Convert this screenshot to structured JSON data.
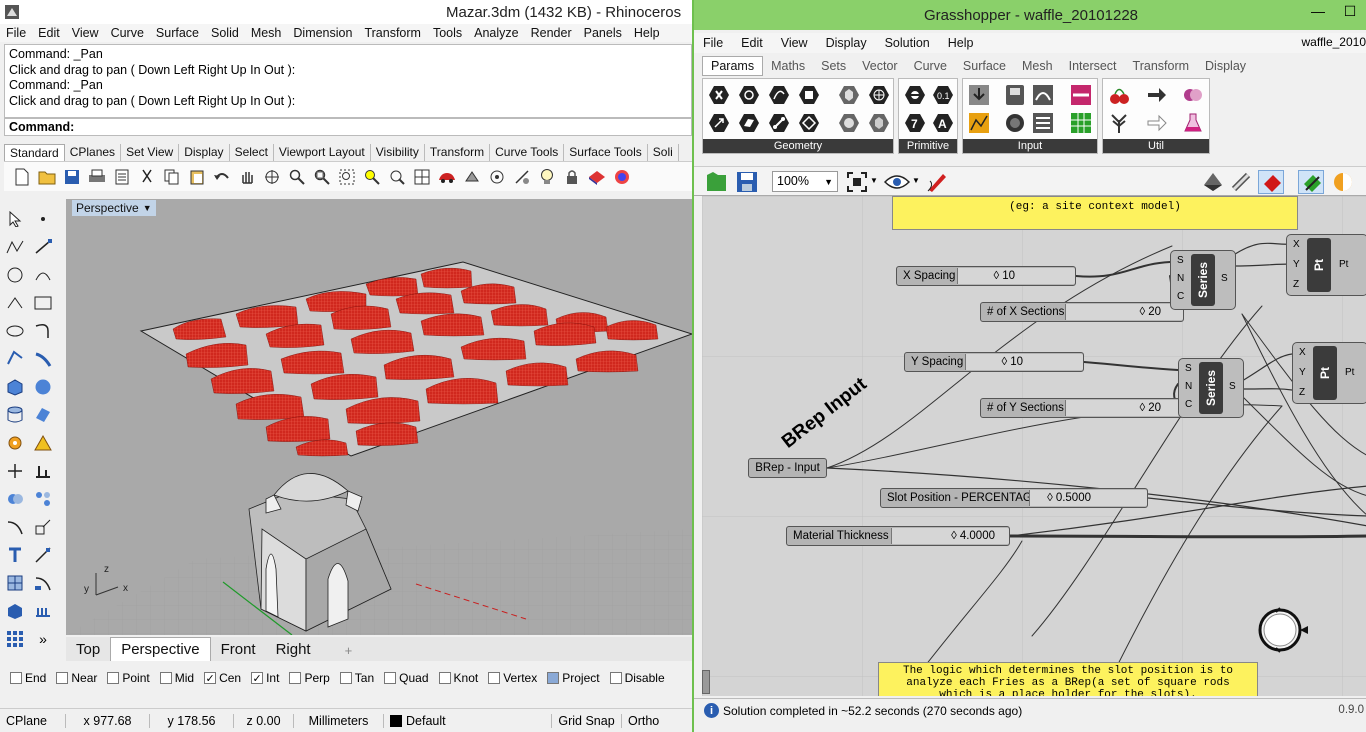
{
  "rhino": {
    "title": "Mazar.3dm (1432 KB) - Rhinoceros",
    "menu": [
      "File",
      "Edit",
      "View",
      "Curve",
      "Surface",
      "Solid",
      "Mesh",
      "Dimension",
      "Transform",
      "Tools",
      "Analyze",
      "Render",
      "Panels",
      "Help"
    ],
    "command_history": [
      "Command: _Pan",
      "Click and drag to pan ( Down  Left  Right  Up  In  Out ):",
      "Command: _Pan",
      "Click and drag to pan ( Down  Left  Right  Up  In  Out ):"
    ],
    "command_prompt": "Command:",
    "toolbar_tabs": [
      "Standard",
      "CPlanes",
      "Set View",
      "Display",
      "Select",
      "Viewport Layout",
      "Visibility",
      "Transform",
      "Curve Tools",
      "Surface Tools",
      "Soli"
    ],
    "viewport_label": "Perspective",
    "viewport_tabs": [
      "Top",
      "Perspective",
      "Front",
      "Right",
      "+"
    ],
    "active_viewport_tab": "Perspective",
    "axis_labels": {
      "x": "x",
      "y": "y",
      "z": "z"
    },
    "osnaps": [
      {
        "label": "End",
        "checked": false
      },
      {
        "label": "Near",
        "checked": false
      },
      {
        "label": "Point",
        "checked": false
      },
      {
        "label": "Mid",
        "checked": false
      },
      {
        "label": "Cen",
        "checked": true
      },
      {
        "label": "Int",
        "checked": true
      },
      {
        "label": "Perp",
        "checked": false
      },
      {
        "label": "Tan",
        "checked": false
      },
      {
        "label": "Quad",
        "checked": false
      },
      {
        "label": "Knot",
        "checked": false
      },
      {
        "label": "Vertex",
        "checked": false
      },
      {
        "label": "Project",
        "checked": true
      },
      {
        "label": "Disable",
        "checked": false
      }
    ],
    "status": {
      "cplane": "CPlane",
      "x": "x 977.68",
      "y": "y 178.56",
      "z": "z 0.00",
      "units": "Millimeters",
      "layer": "Default",
      "grid_snap": "Grid Snap",
      "ortho": "Ortho"
    }
  },
  "grasshopper": {
    "title": "Grasshopper - waffle_20101228",
    "doc_name": "waffle_2010",
    "menu": [
      "File",
      "Edit",
      "View",
      "Display",
      "Solution",
      "Help"
    ],
    "tabs": [
      "Params",
      "Maths",
      "Sets",
      "Vector",
      "Curve",
      "Surface",
      "Mesh",
      "Intersect",
      "Transform",
      "Display"
    ],
    "active_tab": "Params",
    "ribbon_groups": [
      "Geometry",
      "Primitive",
      "Input",
      "Util"
    ],
    "zoom": "100%",
    "note_top": "(eg: a site context model)",
    "group_label": "BRep Input",
    "sliders": [
      {
        "name": "X Spacing",
        "value": "10"
      },
      {
        "name": "# of X Sections",
        "value": "20"
      },
      {
        "name": "Y Spacing",
        "value": "10"
      },
      {
        "name": "# of Y Sections",
        "value": "20"
      },
      {
        "name": "Slot Position - PERCENTAGE",
        "value": "0.5000"
      },
      {
        "name": "Material Thickness",
        "value": "4.0000"
      }
    ],
    "brep_param": "BRep - Input",
    "series_label": "Series",
    "series_inputs": [
      "S",
      "N",
      "C"
    ],
    "series_output": "S",
    "pt_label": "Pt",
    "pt_inputs": [
      "X",
      "Y",
      "Z"
    ],
    "pt_output": "Pt",
    "note_bottom": "The logic which determines the slot position is to analyze each Fries as a BRep(a set of square rods which is a place holder for the slots).",
    "status": "Solution completed in ~52.2 seconds (270 seconds ago)",
    "version": "0.9.0"
  }
}
